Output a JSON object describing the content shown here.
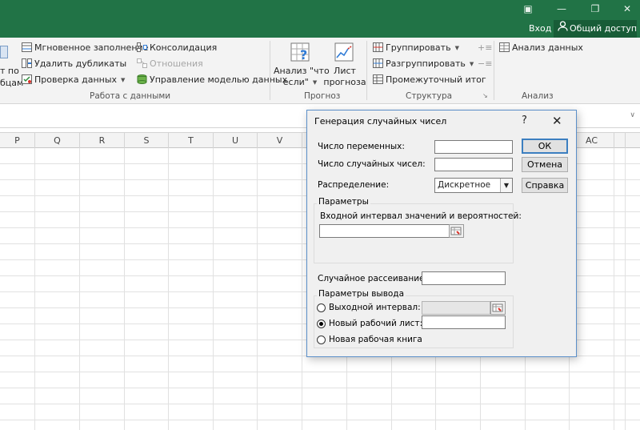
{
  "titlebar": {
    "login_label": "Вход",
    "share_label": "Общий доступ",
    "accent_color": "#217346"
  },
  "ribbon": {
    "partial_text_1": "т по",
    "partial_text_2": "бцам",
    "data_tools": {
      "flash_fill": "Мгновенное заполнение",
      "remove_duplicates": "Удалить дубликаты",
      "data_validation": "Проверка данных",
      "consolidate": "Консолидация",
      "relationships": "Отношения",
      "manage_data_model": "Управление моделью данных",
      "group_label": "Работа с данными"
    },
    "forecast": {
      "what_if_line1": "Анализ \"что",
      "what_if_line2": "если\"",
      "sheet_line1": "Лист",
      "sheet_line2": "прогноза",
      "group_label": "Прогноз"
    },
    "outline": {
      "group": "Группировать",
      "ungroup": "Разгруппировать",
      "subtotal": "Промежуточный итог",
      "group_label": "Структура"
    },
    "analysis": {
      "data_analysis": "Анализ данных",
      "group_label": "Анализ"
    }
  },
  "grid": {
    "columns_left": [
      "P",
      "Q",
      "R",
      "S",
      "T",
      "U",
      "V"
    ],
    "columns_right": [
      "AC"
    ]
  },
  "dialog": {
    "title": "Генерация случайных чисел",
    "help_glyph": "?",
    "close_glyph": "✕",
    "num_variables_label": "Число переменных:",
    "num_variables_value": "",
    "num_random_label": "Число случайных чисел:",
    "num_random_value": "",
    "distribution_label": "Распределение:",
    "distribution_value": "Дискретное",
    "ok_label": "ОК",
    "cancel_label": "Отмена",
    "help_label": "Справка",
    "parameters_label": "Параметры",
    "input_range_label": "Входной интервал значений и вероятностей:",
    "input_range_value": "",
    "random_seed_label": "Случайное рассеивание:",
    "random_seed_value": "",
    "output_options_label": "Параметры вывода",
    "output_range_label": "Выходной интервал:",
    "new_worksheet_label": "Новый рабочий лист:",
    "new_workbook_label": "Новая рабочая книга",
    "selected_output": "new_worksheet"
  }
}
